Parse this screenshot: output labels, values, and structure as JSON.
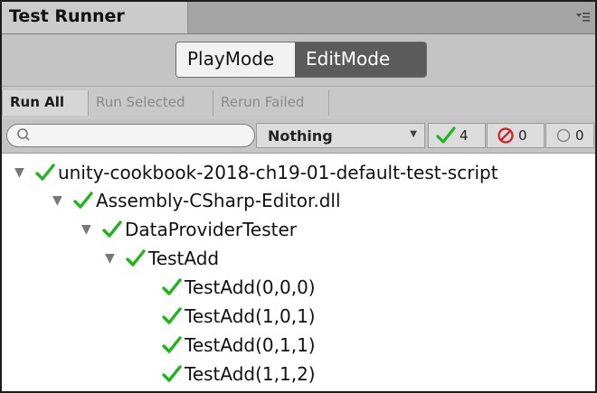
{
  "window": {
    "tab_title": "Test Runner"
  },
  "mode_switch": {
    "play": "PlayMode",
    "edit": "EditMode",
    "selected": "EditMode"
  },
  "toolbar": {
    "run_all": "Run All",
    "run_selected": "Run Selected",
    "rerun_failed": "Rerun Failed"
  },
  "filter": {
    "search_value": "",
    "category_selected": "Nothing",
    "passed_count": "4",
    "failed_count": "0",
    "not_run_count": "0"
  },
  "colors": {
    "pass_green": "#20b51a",
    "fail_red": "#d21f1f",
    "edit_mode_bg": "#5b5b5b"
  },
  "tree": [
    {
      "label": "unity-cookbook-2018-ch19-01-default-test-script",
      "status": "passed",
      "expandable": true
    },
    {
      "label": "Assembly-CSharp-Editor.dll",
      "status": "passed",
      "expandable": true
    },
    {
      "label": "DataProviderTester",
      "status": "passed",
      "expandable": true
    },
    {
      "label": "TestAdd",
      "status": "passed",
      "expandable": true
    },
    {
      "label": "TestAdd(0,0,0)",
      "status": "passed",
      "expandable": false
    },
    {
      "label": "TestAdd(1,0,1)",
      "status": "passed",
      "expandable": false
    },
    {
      "label": "TestAdd(0,1,1)",
      "status": "passed",
      "expandable": false
    },
    {
      "label": "TestAdd(1,1,2)",
      "status": "passed",
      "expandable": false
    }
  ]
}
